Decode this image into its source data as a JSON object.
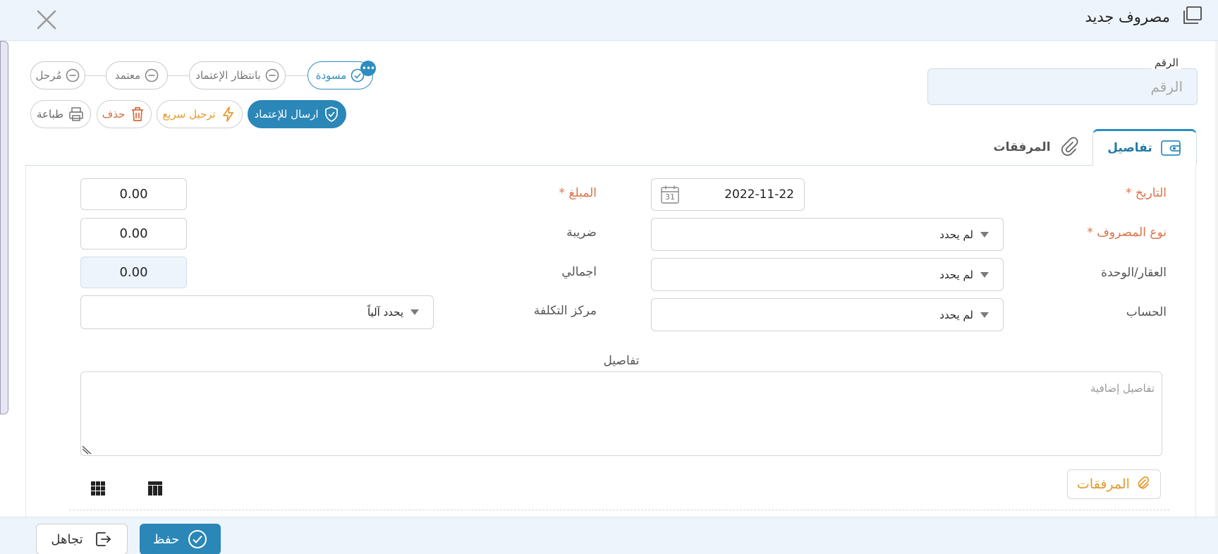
{
  "window": {
    "title": "مصروف جديد",
    "icon": "window-stack-icon",
    "close_icon": "close-icon"
  },
  "number_field": {
    "label": "الرقم",
    "placeholder": "الرقم"
  },
  "status_steps": [
    {
      "label": "مسودة",
      "icon": "check-circle-icon",
      "active": true
    },
    {
      "label": "بانتظار الإعتماد",
      "icon": "minus-circle-icon",
      "active": false
    },
    {
      "label": "معتمد",
      "icon": "minus-circle-icon",
      "active": false
    },
    {
      "label": "مُرحل",
      "icon": "minus-circle-icon",
      "active": false
    }
  ],
  "status_more": "•••",
  "actions": {
    "submit": "ارسال للإعتماد",
    "quick_post": "ترحيل سريع",
    "delete": "حذف",
    "print": "طباعة"
  },
  "tabs": [
    {
      "label": "تفاصيل",
      "icon": "wallet-icon",
      "active": true
    },
    {
      "label": "المرفقات",
      "icon": "paperclip-icon",
      "active": false
    }
  ],
  "form": {
    "date": {
      "label": "التاريخ *",
      "value": "2022-11-22",
      "calendar_day": "31"
    },
    "expense_type": {
      "label": "نوع المصروف *",
      "value": "لم يحدد"
    },
    "property_unit": {
      "label": "العقار/الوحدة",
      "value": "لم يحدد"
    },
    "account": {
      "label": "الحساب",
      "value": "لم يحدد"
    },
    "amount": {
      "label": "المبلغ *",
      "value": "0.00"
    },
    "tax": {
      "label": "ضريبة",
      "value": "0.00"
    },
    "total": {
      "label": "اجمالي",
      "value": "0.00"
    },
    "cost_center": {
      "label": "مركز التكلفة",
      "value": "يحدد آلياً"
    },
    "details": {
      "label": "تفاصيل",
      "placeholder": "تفاصيل إضافية"
    }
  },
  "attachments_button": "المرفقات",
  "footer": {
    "save": "حفظ",
    "ignore": "تجاهل"
  },
  "colors": {
    "primary": "#2a87b7",
    "required": "#d9734a",
    "orange": "#e39a2d",
    "header_bg": "#eef4fb"
  }
}
